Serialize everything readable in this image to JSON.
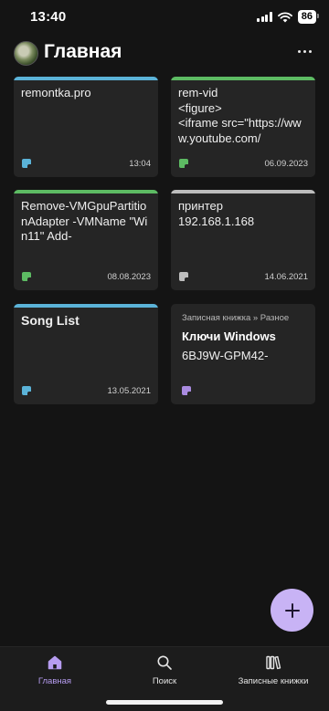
{
  "status": {
    "time": "13:40",
    "battery": "86"
  },
  "header": {
    "title": "Главная"
  },
  "notes": [
    {
      "text": "remontka.pro",
      "date": "13:04",
      "accent": "#5bb3d8",
      "icon_color": "#5bb3d8"
    },
    {
      "text": "rem-vid\n<figure>\n<iframe src=\"https://www.youtube.com/",
      "date": "06.09.2023",
      "accent": "#5dbb63",
      "icon_color": "#5dbb63"
    },
    {
      "text": "Remove-VMGpuPartitionAdapter -VMName \"Win11\" Add-",
      "date": "08.08.2023",
      "accent": "#5dbb63",
      "icon_color": "#5dbb63"
    },
    {
      "text": "принтер\n192.168.1.168",
      "date": "14.06.2021",
      "accent": "#bdbdbd",
      "icon_color": "#bdbdbd"
    },
    {
      "text": "Song List",
      "date": "13.05.2021",
      "accent": "#5bb3d8",
      "icon_color": "#5bb3d8"
    },
    {
      "notebook": "Записная книжка » Разное",
      "title": "Ключи Windows",
      "body": "6BJ9W-GPM42-",
      "icon_color": "#a98be0"
    }
  ],
  "fab": {
    "icon": "plus-icon",
    "color": "#c8b3f5"
  },
  "nav": {
    "home": "Главная",
    "search": "Поиск",
    "notebooks": "Записные книжки"
  },
  "colors": {
    "active": "#b69cf0",
    "background": "#141414",
    "card": "#252525"
  }
}
